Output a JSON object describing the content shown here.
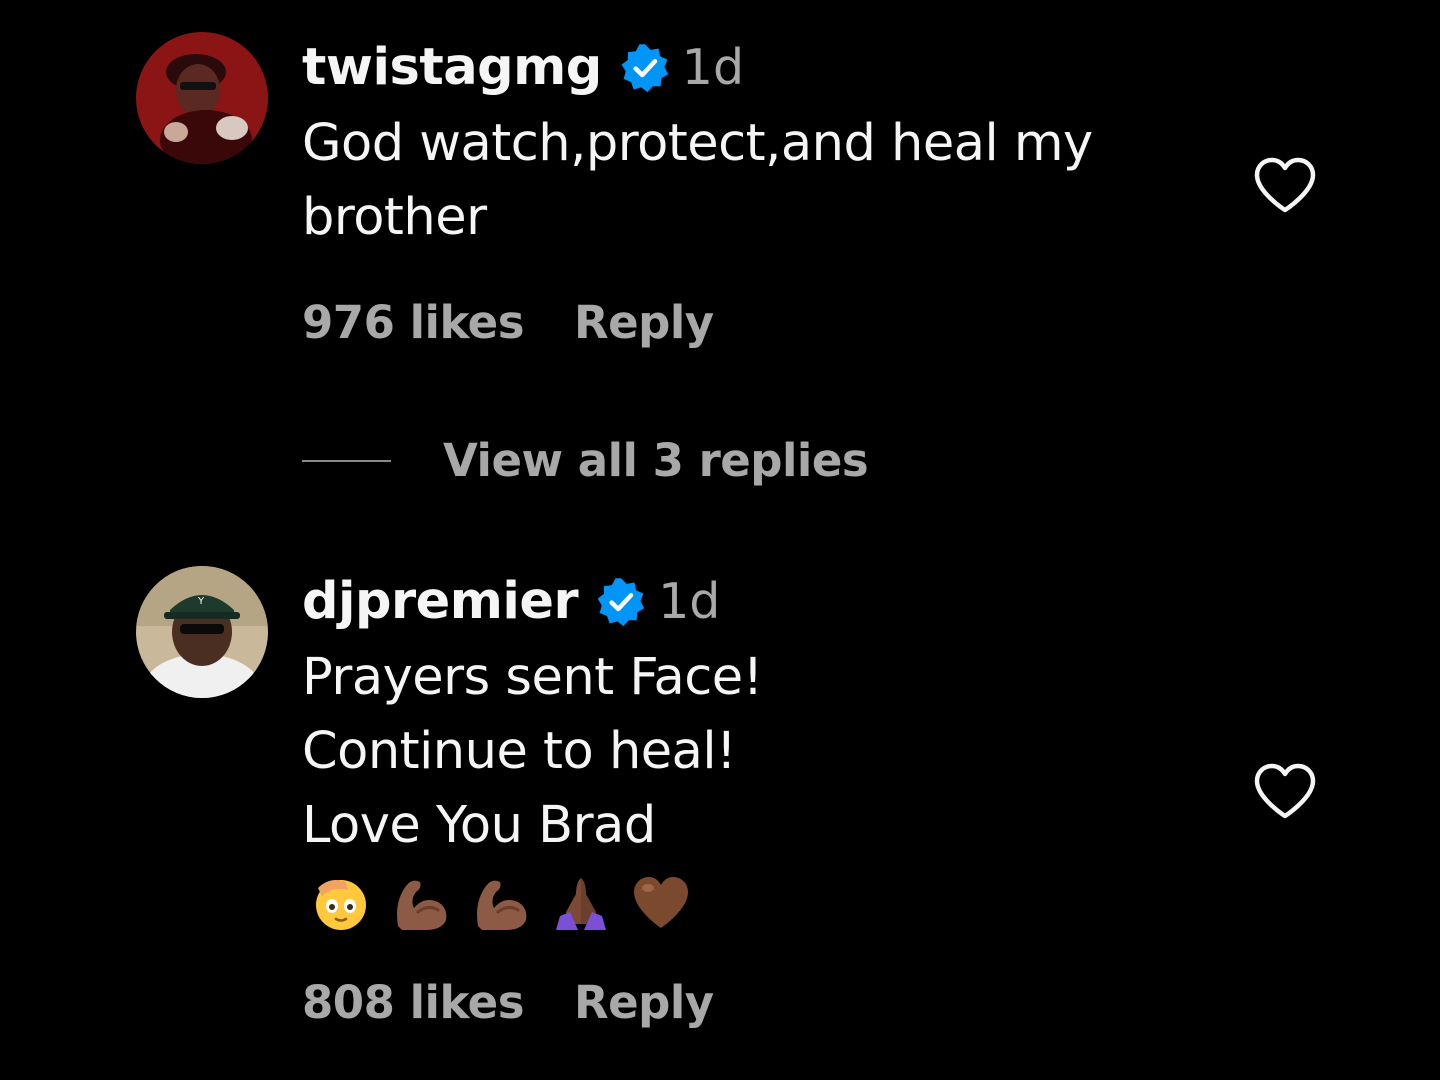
{
  "comments": [
    {
      "username": "twistagmg",
      "verified": true,
      "time": "1d",
      "text_lines": [
        "God watch,protect,and heal my",
        "brother"
      ],
      "emojis": [],
      "likes": "976 likes",
      "reply_label": "Reply",
      "view_replies_label": "View all 3 replies"
    },
    {
      "username": "djpremier",
      "verified": true,
      "time": "1d",
      "text_lines": [
        "Prayers sent Face!",
        "Continue to heal!",
        "Love You Brad"
      ],
      "emojis": [
        "saluting-face-emoji",
        "flexed-biceps-emoji",
        "flexed-biceps-emoji",
        "folded-hands-emoji",
        "brown-heart-emoji"
      ],
      "likes": "808 likes",
      "reply_label": "Reply"
    }
  ],
  "colors": {
    "background": "#000000",
    "primary_text": "#f5f5f5",
    "secondary_text": "#a8a8a8",
    "verified_badge": "#0095f6"
  }
}
